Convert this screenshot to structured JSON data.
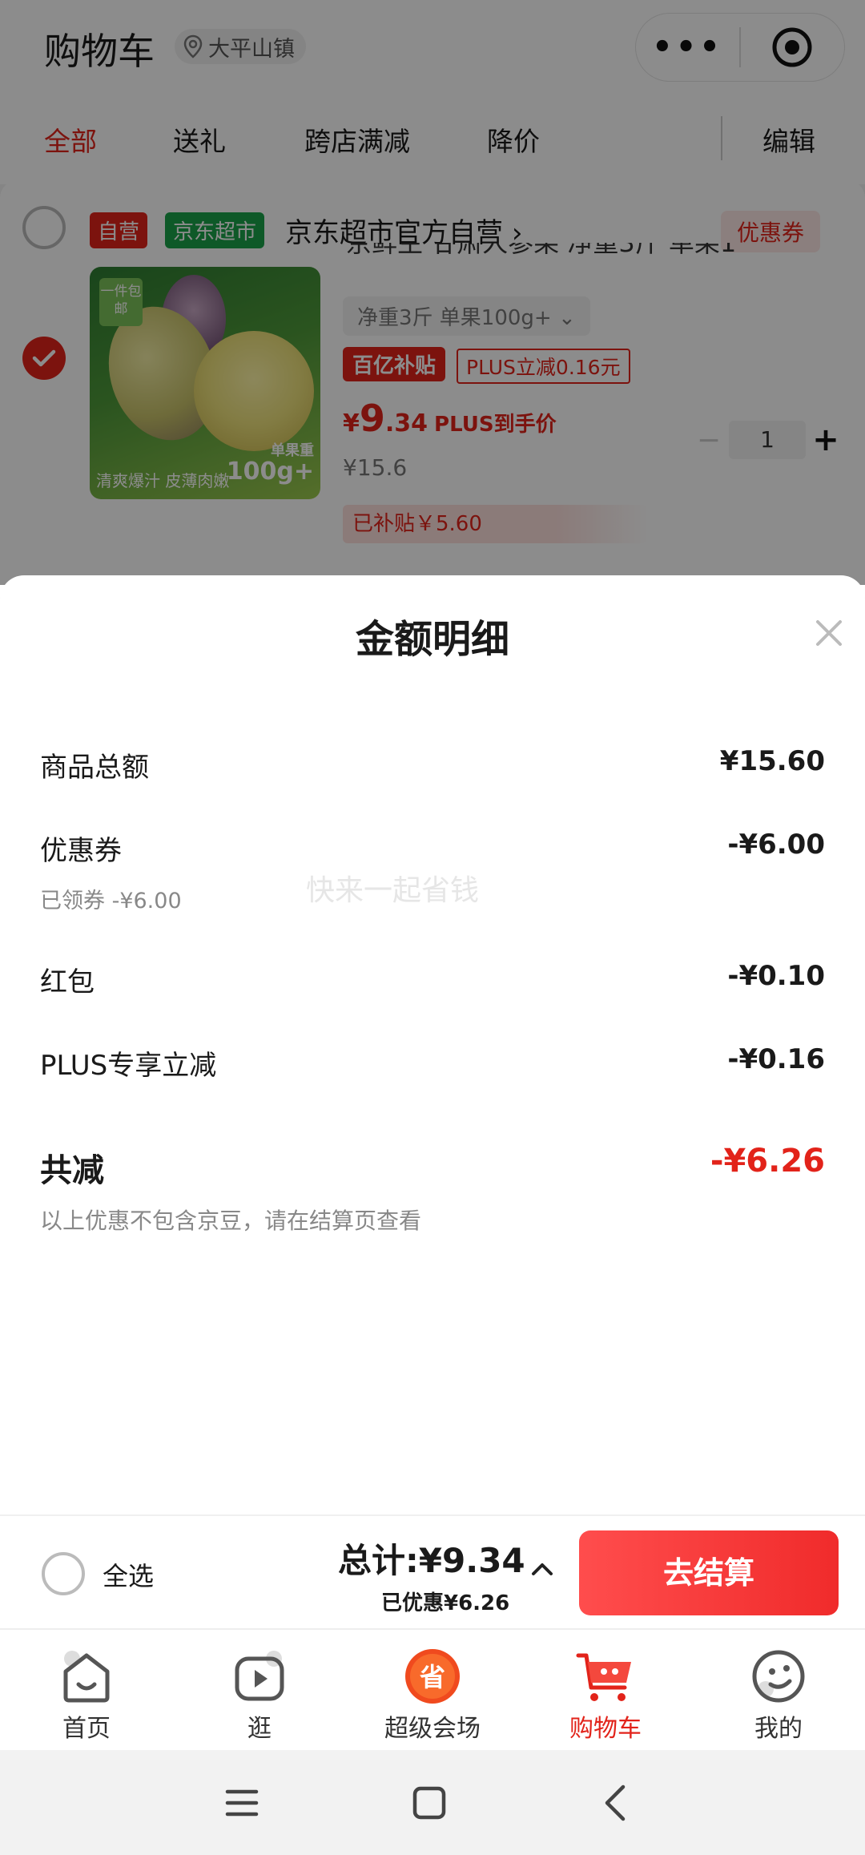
{
  "header": {
    "title": "购物车",
    "location": "大平山镇"
  },
  "tabs": [
    "全部",
    "送礼",
    "跨店满减",
    "降价"
  ],
  "tabs_edit": "编辑",
  "store": {
    "badge_self": "自营",
    "badge_market": "京东超市",
    "name": "京东超市官方自营",
    "coupon": "优惠券"
  },
  "product": {
    "image_tag": "一件包邮",
    "image_label_line1": "单果重",
    "image_label_line2": "100g+",
    "image_slogan": "清爽爆汁 皮薄肉嫩",
    "title": "京鲜生 甘肃人参果 净重3斤 单果1",
    "spec": "净重3斤 单果100g+",
    "subsidy_logo": "百亿补贴",
    "plus_reduce": "PLUS立减0.16元",
    "price_symbol": "¥",
    "price_int": "9",
    "price_dec": ".34",
    "price_note": "PLUS到手价",
    "original_price": "¥15.6",
    "quantity": "1",
    "subsidized": "已补贴￥5.60"
  },
  "sheet": {
    "title": "金额明细",
    "rows": [
      {
        "label": "商品总额",
        "value": "¥15.60"
      },
      {
        "label": "优惠券",
        "value": "-¥6.00",
        "sub": "已领券 -¥6.00"
      },
      {
        "label": "红包",
        "value": "-¥0.10"
      },
      {
        "label": "PLUS专享立减",
        "value": "-¥0.16"
      }
    ],
    "watermark": "快来一起省钱",
    "total_label": "共减",
    "total_value": "-¥6.26",
    "total_note": "以上优惠不包含京豆，请在结算页查看"
  },
  "checkout": {
    "select_all": "全选",
    "total": "总计:¥9.34",
    "saved": "已优惠¥6.26",
    "button": "去结算"
  },
  "nav": [
    {
      "label": "首页",
      "icon": "home-icon"
    },
    {
      "label": "逛",
      "icon": "video-icon"
    },
    {
      "label": "超级会场",
      "icon": "super-venue-icon"
    },
    {
      "label": "购物车",
      "icon": "cart-icon",
      "active": true
    },
    {
      "label": "我的",
      "icon": "profile-icon"
    }
  ],
  "colors": {
    "accent": "#e2231a",
    "green_badge": "#1ba34a",
    "checkout_button": "#f02b2b"
  }
}
